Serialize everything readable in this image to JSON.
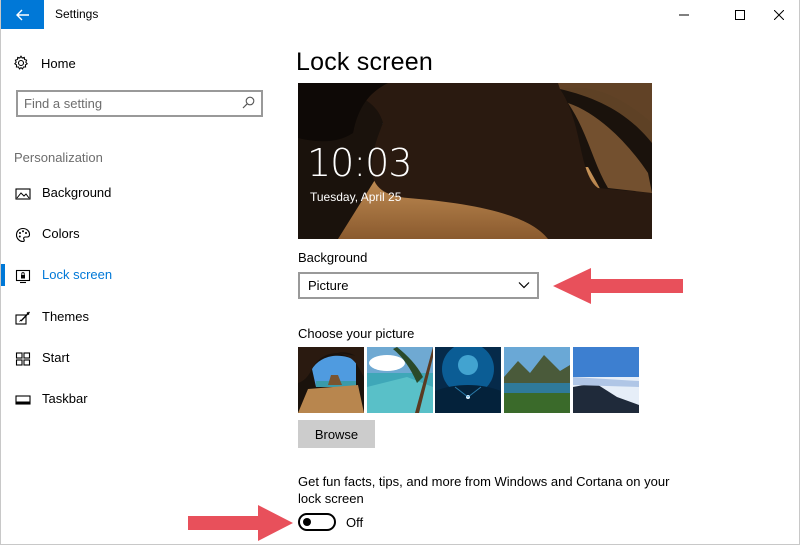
{
  "window": {
    "title": "Settings",
    "back_icon": "back-arrow-icon",
    "minimize_icon": "minimize-icon",
    "maximize_icon": "maximize-icon",
    "close_icon": "close-icon",
    "accent_color": "#0078d7"
  },
  "sidebar": {
    "home_label": "Home",
    "home_icon": "gear-icon",
    "search_placeholder": "Find a setting",
    "search_icon": "search-icon",
    "section_title": "Personalization",
    "items": [
      {
        "label": "Background",
        "icon": "image-icon",
        "active": false
      },
      {
        "label": "Colors",
        "icon": "palette-icon",
        "active": false
      },
      {
        "label": "Lock screen",
        "icon": "lock-screen-icon",
        "active": true
      },
      {
        "label": "Themes",
        "icon": "brush-icon",
        "active": false
      },
      {
        "label": "Start",
        "icon": "start-icon",
        "active": false
      },
      {
        "label": "Taskbar",
        "icon": "taskbar-icon",
        "active": false
      }
    ]
  },
  "main": {
    "page_title": "Lock screen",
    "preview": {
      "time": "10:03",
      "date": "Tuesday, April 25"
    },
    "background_label": "Background",
    "background_value": "Picture",
    "choose_label": "Choose your picture",
    "thumbnails": [
      "cave-beach",
      "palm-water",
      "underwater-diver",
      "mountain-lake",
      "snow-cliff"
    ],
    "browse_label": "Browse",
    "facts_text": "Get fun facts, tips, and more from Windows and Cortana on your lock screen",
    "toggle_state": "Off",
    "annotation_color": "#e8505b"
  }
}
